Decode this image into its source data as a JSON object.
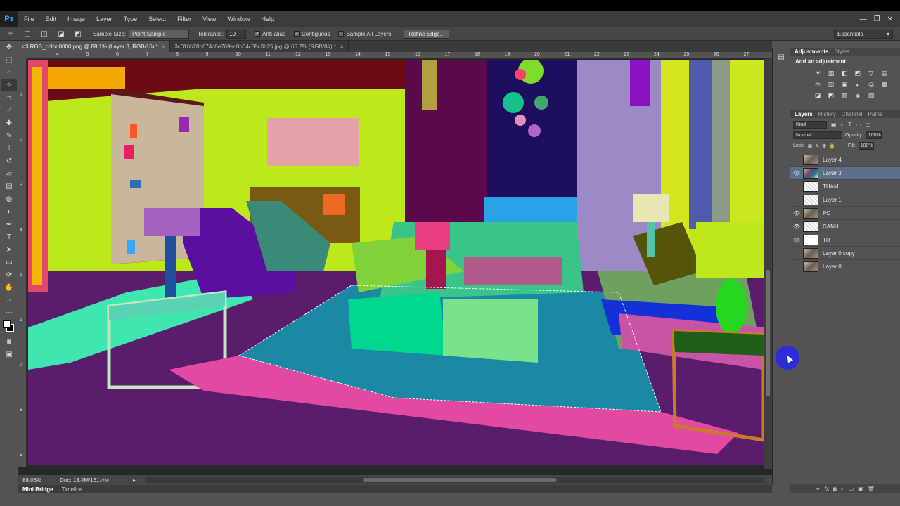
{
  "app": {
    "logo": "Ps",
    "minimize": "—",
    "restore": "❐",
    "close": "✕"
  },
  "menu": [
    "File",
    "Edit",
    "Image",
    "Layer",
    "Type",
    "Select",
    "Filter",
    "View",
    "Window",
    "Help"
  ],
  "options": {
    "sample_size_label": "Sample Size:",
    "sample_size_value": "Point Sample",
    "tolerance_label": "Tolerance:",
    "tolerance_value": "10",
    "anti_alias": "Anti-alias",
    "contiguous": "Contiguous",
    "sample_all_layers": "Sample All Layers",
    "refine_edge": "Refine Edge...",
    "workspace": "Essentials"
  },
  "tabs": [
    {
      "label": "c3.RGB_color.0000.png @ 88.1% (Layer 3, RGB/16) *",
      "close": "×"
    },
    {
      "label": "3c016b28b674c8e769ec0b04c39c3b25.jpg @ 66.7% (RGB/8#) *",
      "close": "×"
    }
  ],
  "ruler_h": [
    "4",
    "5",
    "6",
    "7",
    "8",
    "9",
    "10",
    "11",
    "12",
    "13",
    "14",
    "15",
    "16",
    "17",
    "18",
    "19",
    "20",
    "21",
    "22",
    "23",
    "24",
    "25",
    "26",
    "27",
    "28"
  ],
  "ruler_v": [
    "1",
    "2",
    "3",
    "4",
    "5",
    "6",
    "7",
    "8",
    "9"
  ],
  "status": {
    "zoom": "88.06%",
    "doc": "Doc: 18.4M/161.4M"
  },
  "bottom_tabs": [
    "Mini Bridge",
    "Timeline"
  ],
  "adjustments": {
    "tabs": [
      "Adjustments",
      "Styles"
    ],
    "title": "Add an adjustment",
    "icons": [
      "☀",
      "▥",
      "◧",
      "◩",
      "▽",
      "▤",
      "⚖",
      "◫",
      "▣",
      "◐",
      "◎",
      "▦",
      "◪",
      "◩",
      "▨",
      "◈",
      "▧"
    ]
  },
  "layers": {
    "tabs": [
      "Layers",
      "History",
      "Channel",
      "Paths"
    ],
    "kind": "Kind",
    "blend_mode": "Normal",
    "opacity_label": "Opacity:",
    "opacity_value": "100%",
    "lock_label": "Lock:",
    "fill_label": "Fill:",
    "fill_value": "100%",
    "items": [
      {
        "name": "Layer 4",
        "visible": false,
        "thumb": "photo"
      },
      {
        "name": "Layer 3",
        "visible": true,
        "thumb": "room",
        "selected": true
      },
      {
        "name": "THAM",
        "visible": false,
        "thumb": "checker"
      },
      {
        "name": "Layer 1",
        "visible": false,
        "thumb": "checker"
      },
      {
        "name": "PC",
        "visible": true,
        "thumb": "photo"
      },
      {
        "name": "CANH",
        "visible": true,
        "thumb": "checker"
      },
      {
        "name": "TR",
        "visible": true,
        "thumb": "white"
      },
      {
        "name": "Layer 0 copy",
        "visible": false,
        "thumb": "photo"
      },
      {
        "name": "Layer 0",
        "visible": false,
        "thumb": "photo"
      }
    ]
  }
}
